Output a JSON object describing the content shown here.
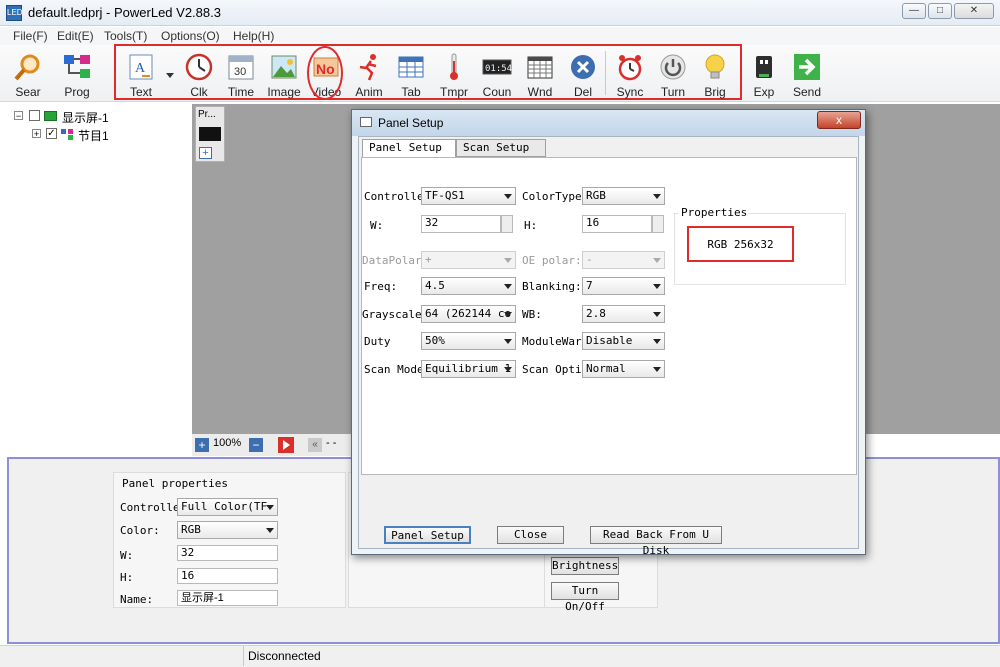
{
  "window": {
    "title": "default.ledprj - PowerLed V2.88.3",
    "app_icon": "LED"
  },
  "menu": [
    "File(F)",
    "Edit(E)",
    "Tools(T)",
    "Options(O)",
    "Help(H)"
  ],
  "toolbar": {
    "sear": "Sear",
    "prog": "Prog",
    "text": "Text",
    "clk": "Clk",
    "time": "Time",
    "time_num": "30",
    "image": "Image",
    "video": "Video",
    "video_mark": "No",
    "anim": "Anim",
    "tab": "Tab",
    "tmpr": "Tmpr",
    "coun": "Coun",
    "coun_display": "01:54",
    "wnd": "Wnd",
    "del": "Del",
    "sync": "Sync",
    "turn": "Turn",
    "brig": "Brig",
    "exp": "Exp",
    "send": "Send"
  },
  "tree": {
    "screen": "显示屏-1",
    "program": "节目1"
  },
  "preview": {
    "tab_label": "Pr...",
    "zoom": "100%",
    "dashes": "- -"
  },
  "panel_properties": {
    "title": "Panel properties",
    "controller_label": "Controlle:",
    "controller_value": "Full Color(TF-",
    "color_label": "Color:",
    "color_value": "RGB",
    "w_label": "W:",
    "w_value": "32",
    "h_label": "H:",
    "h_value": "16",
    "name_label": "Name:",
    "name_value": "显示屏-1"
  },
  "bottom_buttons": {
    "brightness": "Brightness",
    "turn_onoff": "Turn On/Off"
  },
  "status": {
    "connection": "Disconnected"
  },
  "dialog": {
    "title": "Panel Setup",
    "close_x": "x",
    "tabs": [
      "Panel Setup",
      "Scan Setup"
    ],
    "controller_label": "Controller",
    "controller_value": "TF-QS1",
    "colortype_label": "ColorType:",
    "colortype_value": "RGB",
    "w_label": "W:",
    "w_value": "32",
    "h_label": "H:",
    "h_value": "16",
    "datapolar_label": "DataPolar:",
    "datapolar_value": "+",
    "oepolar_label": "OE polar:",
    "oepolar_value": "-",
    "freq_label": "Freq:",
    "freq_value": "4.5",
    "blanking_label": "Blanking:",
    "blanking_value": "7",
    "grayscale_label": "Grayscale:",
    "grayscale_value": "64 (262144 co",
    "wb_label": "WB:",
    "wb_value": "2.8",
    "duty_label": "Duty",
    "duty_value": "50%",
    "modulewarp_label": "ModuleWarp:",
    "modulewarp_value": "Disable",
    "scanmode_label": "Scan Mode:",
    "scanmode_value": "Equilibrium 1",
    "scanoptim_label": "Scan Optimi",
    "scanoptim_value": "Normal",
    "properties_label": "Properties",
    "properties_value": "RGB 256x32",
    "btn_panel_setup": "Panel Setup",
    "btn_close": "Close",
    "btn_read_back": "Read Back From U Disk"
  },
  "colors": {
    "highlight": "#e02b2b",
    "accent": "#8f8fd8"
  }
}
